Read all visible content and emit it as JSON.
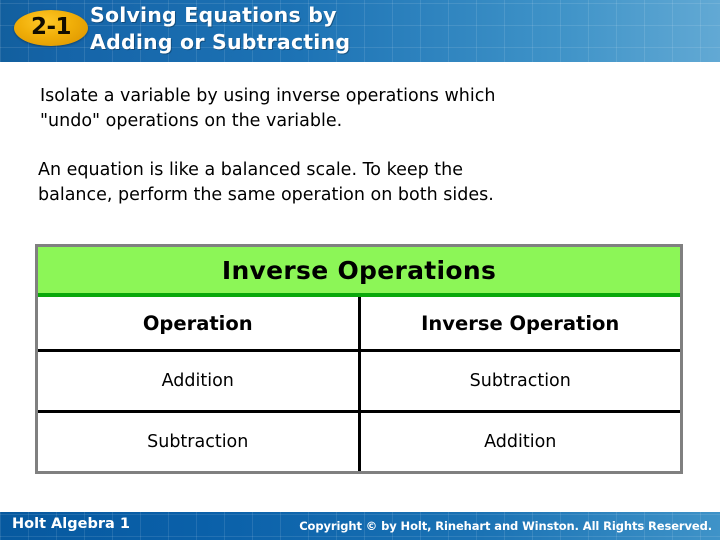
{
  "header": {
    "badge_number": "2-1",
    "title_line1": "Solving Equations by",
    "title_line2": "Adding or Subtracting",
    "banner_color_left": "#125f9e",
    "banner_color_right": "#62a9d4",
    "badge_color": "#f0ae08"
  },
  "body": {
    "paragraph1_line1": "Isolate a variable by using inverse operations which",
    "paragraph1_line2": "\"undo\" operations on the variable.",
    "paragraph2_line1": "An equation is like a balanced scale. To keep the",
    "paragraph2_line2": "balance, perform the same operation on both sides."
  },
  "table": {
    "title": "Inverse Operations",
    "title_bg_color": "#8cf657",
    "title_rule_color": "#0aa80a",
    "frame_color": "#808080",
    "columns": [
      "Operation",
      "Inverse Operation"
    ],
    "rows": [
      {
        "operation": "Addition",
        "inverse": "Subtraction"
      },
      {
        "operation": "Subtraction",
        "inverse": "Addition"
      }
    ]
  },
  "footer": {
    "book_title": "Holt Algebra 1",
    "copyright": "Copyright © by Holt, Rinehart and Winston. All Rights Reserved."
  }
}
